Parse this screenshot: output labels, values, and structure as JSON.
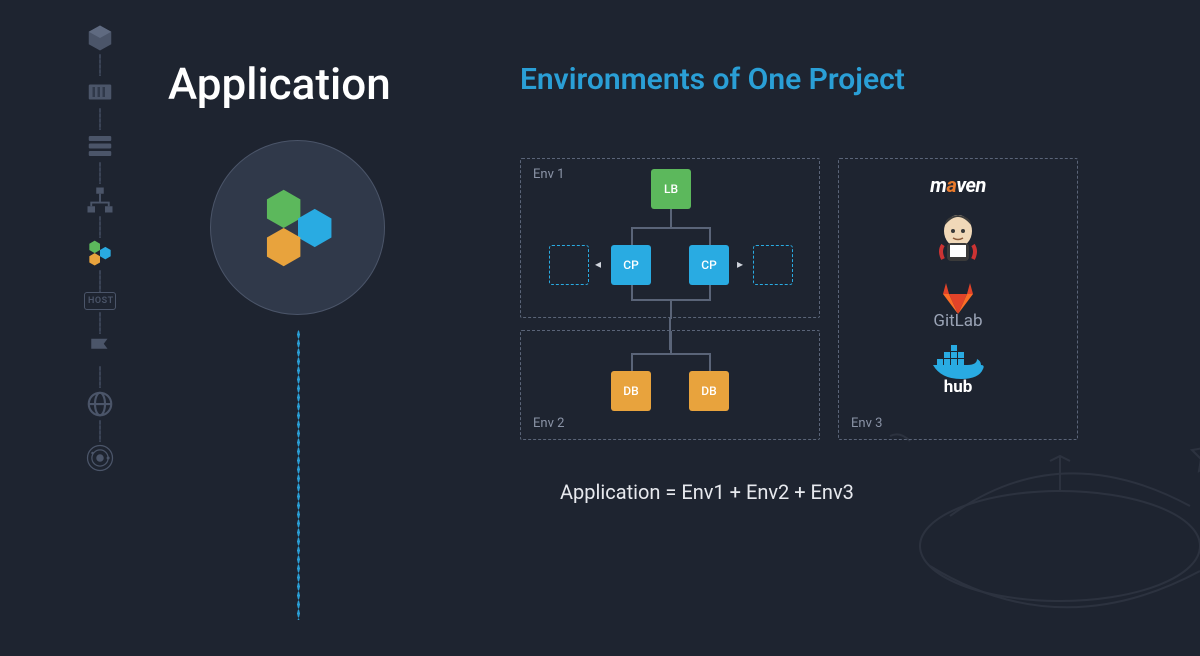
{
  "nav": {
    "items": [
      {
        "name": "cube-icon"
      },
      {
        "name": "container-icon"
      },
      {
        "name": "stack-icon"
      },
      {
        "name": "topology-icon"
      },
      {
        "name": "hex-cluster-icon",
        "active": true
      },
      {
        "name": "host-icon",
        "label": "HOST"
      },
      {
        "name": "flag-icon"
      },
      {
        "name": "globe-icon"
      },
      {
        "name": "orbit-icon"
      }
    ]
  },
  "left": {
    "title": "Application",
    "hero_icon": "hex-cluster-icon"
  },
  "right": {
    "title": "Environments of One Project",
    "env1": {
      "label": "Env 1",
      "lb": "LB",
      "cp": "CP"
    },
    "env2": {
      "label": "Env 2",
      "db": "DB"
    },
    "env3": {
      "label": "Env 3",
      "tools": {
        "maven": "maven",
        "jenkins": "Jenkins",
        "gitlab": "GitLab",
        "dockerhub": "hub"
      }
    },
    "formula": "Application = Env1 + Env2 + Env3"
  },
  "colors": {
    "bg": "#1e2430",
    "accent": "#2a9fd6",
    "green": "#5cb85c",
    "blue": "#29abe2",
    "orange": "#e8a33d",
    "muted": "#5a6478"
  }
}
